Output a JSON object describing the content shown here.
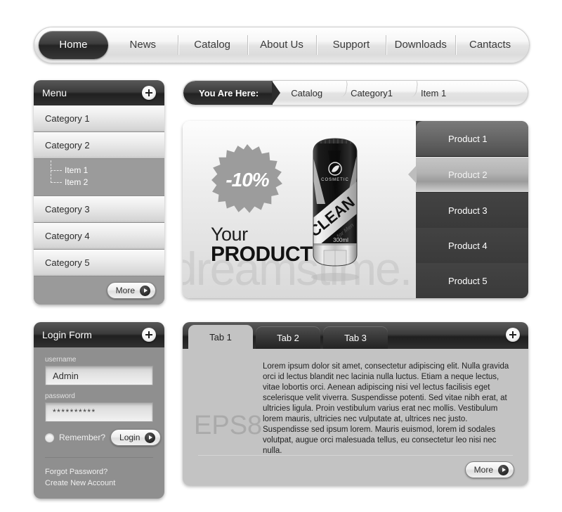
{
  "topnav": {
    "items": [
      {
        "label": "Home",
        "active": true
      },
      {
        "label": "News",
        "active": false
      },
      {
        "label": "Catalog",
        "active": false
      },
      {
        "label": "About Us",
        "active": false
      },
      {
        "label": "Support",
        "active": false
      },
      {
        "label": "Downloads",
        "active": false
      },
      {
        "label": "Cantacts",
        "active": false
      }
    ]
  },
  "menu": {
    "title": "Menu",
    "categories": [
      "Category 1",
      "Category 2",
      "Category 3",
      "Category 4",
      "Category 5"
    ],
    "subitems": [
      "Item 1",
      "Item 2"
    ],
    "more_label": "More"
  },
  "breadcrumb": {
    "here_label": "You Are Here:",
    "crumbs": [
      "Catalog",
      "Category1",
      "Item 1"
    ]
  },
  "slider": {
    "badge_text": "-10%",
    "headline_line1": "Your",
    "headline_line2": "PRODUCT",
    "watermark": "dreamstime.",
    "tube": {
      "brand": "COSMETIC",
      "name": "CLEAN",
      "subname": "for Men",
      "volume": "300ml"
    },
    "products": [
      {
        "label": "Product 1",
        "state": "top"
      },
      {
        "label": "Product 2",
        "state": "selected"
      },
      {
        "label": "Product 3",
        "state": "normal"
      },
      {
        "label": "Product 4",
        "state": "normal"
      },
      {
        "label": "Product 5",
        "state": "normal"
      }
    ]
  },
  "login": {
    "title": "Login Form",
    "username_label": "username",
    "username_value": "Admin",
    "password_label": "password",
    "password_value": "**********",
    "remember_label": "Remember?",
    "login_label": "Login",
    "forgot_link": "Forgot Password?",
    "create_link": "Create New Account"
  },
  "tabs": {
    "items": [
      {
        "label": "Tab 1",
        "active": true
      },
      {
        "label": "Tab 2",
        "active": false
      },
      {
        "label": "Tab 3",
        "active": false
      }
    ],
    "eps_label": "EPS8",
    "body": "Lorem ipsum dolor sit amet, consectetur adipiscing elit. Nulla gravida orci id lectus blandit nec lacinia nulla luctus. Etiam a neque lectus, vitae lobortis orci. Aenean adipiscing nisi vel lectus facilisis eget scelerisque velit viverra. Suspendisse potenti. Sed vitae nibh erat, at ultricies ligula. Proin vestibulum varius erat nec mollis. Vestibulum lorem mauris, ultricies nec vulputate at, ultrices nec justo. Suspendisse sed ipsum lorem. Mauris euismod, lorem id sodales volutpat, augue orci malesuada tellus, eu consectetur leo nisi nec nulla.",
    "more_label": "More"
  },
  "colors": {
    "dark_header": "#2b2b2b",
    "panel_gray": "#9a9a9a",
    "tab_body": "#c3c3c3",
    "text_dark": "#2b2b2b",
    "text_light": "#ffffff"
  }
}
